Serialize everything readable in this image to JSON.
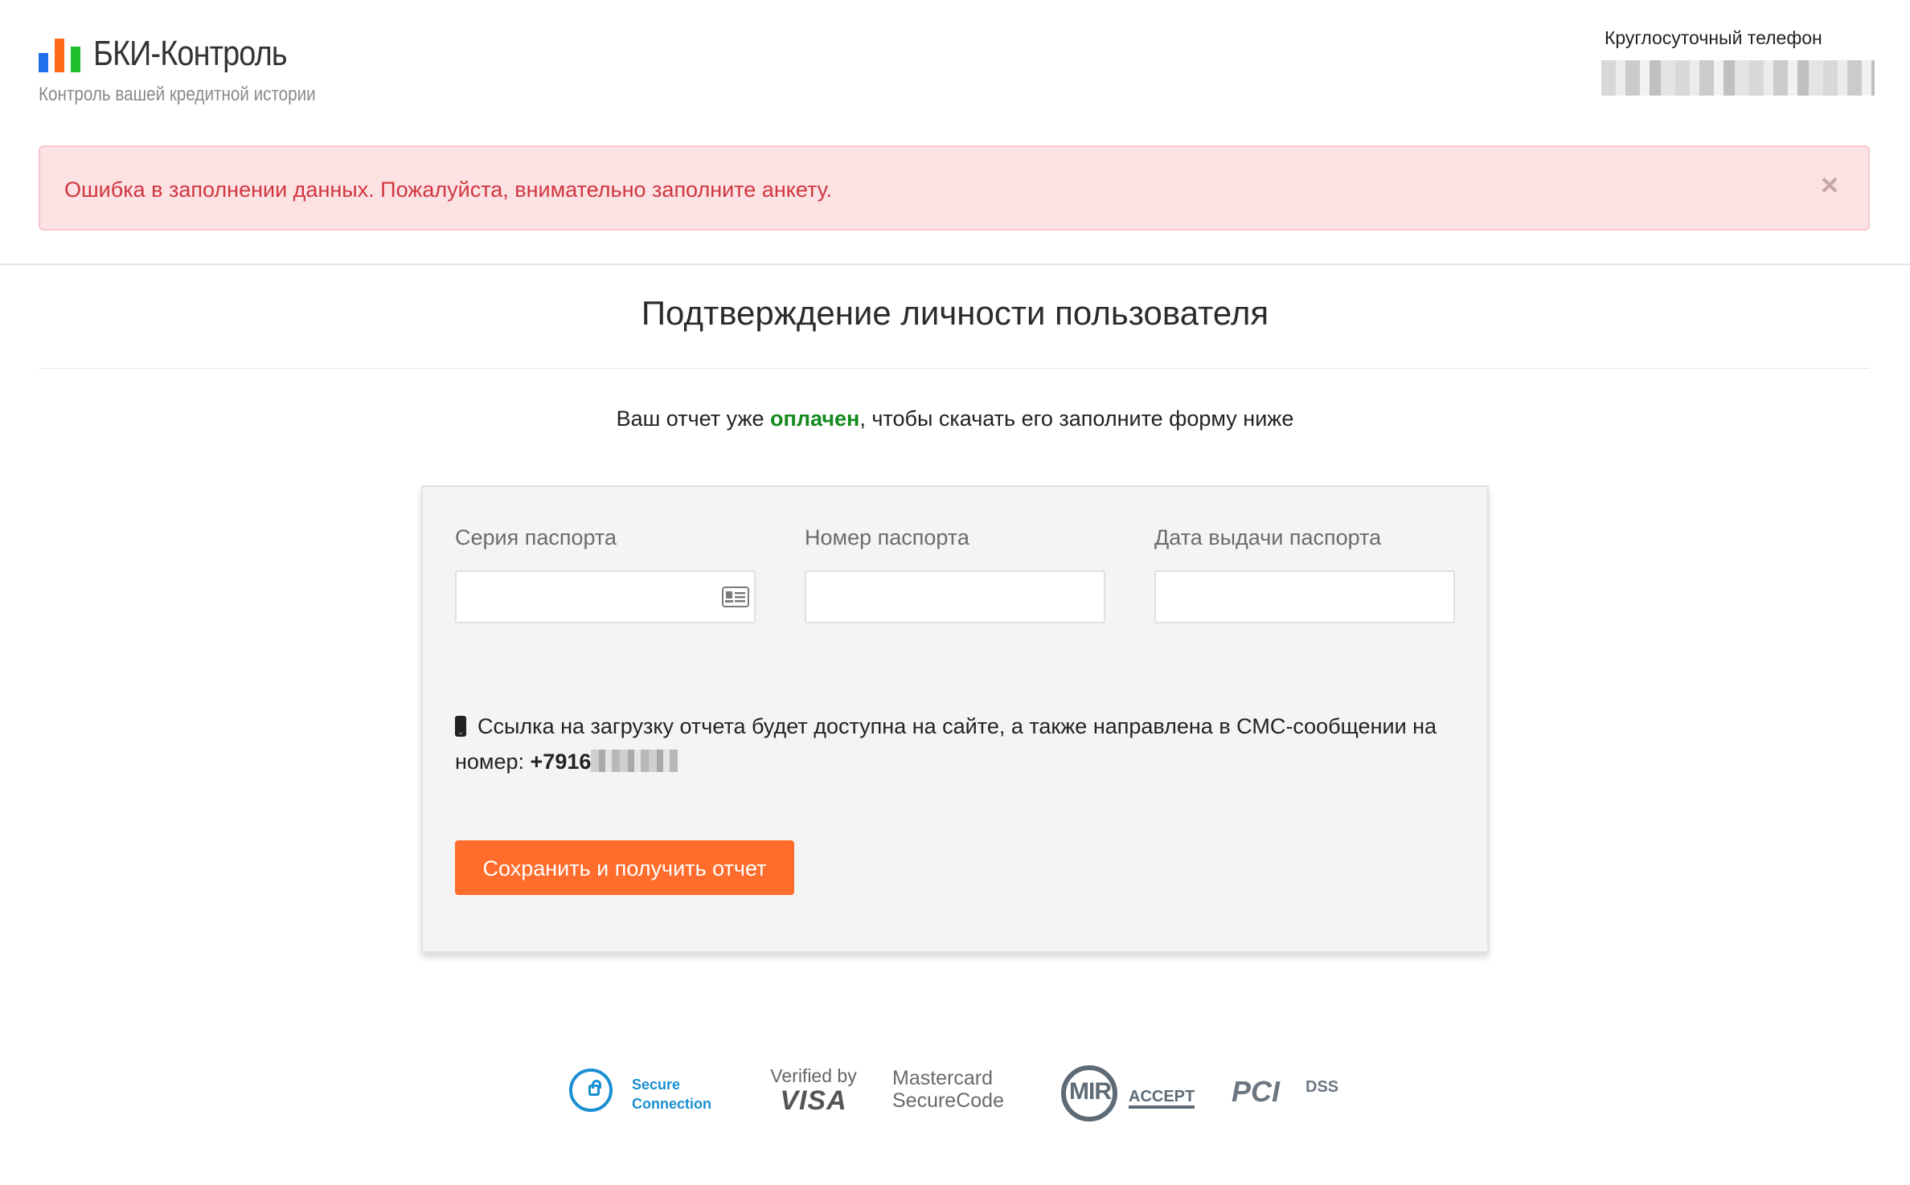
{
  "header": {
    "logo_title": "БКИ-Контроль",
    "logo_subtitle": "Контроль вашей кредитной истории",
    "phone_label": "Круглосуточный телефон",
    "logo_bar_colors": [
      "#1f6feb",
      "#ff6a1a",
      "#1fbf2c"
    ]
  },
  "alert": {
    "message": "Ошибка в заполнении данных. Пожалуйста, внимательно заполните анкету.",
    "close_symbol": "×",
    "background_color": "#fde2e4",
    "text_color": "#d0363f"
  },
  "page": {
    "title": "Подтверждение личности пользователя",
    "subtitle_before": "Ваш отчет уже ",
    "subtitle_highlight": "оплачен",
    "subtitle_after": ", чтобы скачать его заполните форму ниже",
    "highlight_color": "#148a1d"
  },
  "form": {
    "fields": [
      {
        "label": "Серия паспорта",
        "value": "",
        "icon": "id-card-icon"
      },
      {
        "label": "Номер паспорта",
        "value": ""
      },
      {
        "label": "Дата выдачи паспорта",
        "value": ""
      }
    ],
    "sms_note": "Ссылка на загрузку отчета будет доступна на сайте, а также направлена в СМС-сообщении на номер: ",
    "sms_number_visible": "+7916",
    "sms_icon": "mobile-phone-icon",
    "submit_label": "Сохранить и получить отчет",
    "submit_color": "#ff6c2b"
  },
  "footer": {
    "badges": {
      "secure_line1": "Secure",
      "secure_line2": "Connection",
      "visa_top": "Verified by",
      "visa_bottom": "VISA",
      "mc_line1": "Mastercard",
      "mc_line2": "SecureCode",
      "mir_logo": "MIR",
      "mir_accept": "ACCEPT",
      "pci_logo": "PCI",
      "pci_dss": "DSS"
    }
  }
}
